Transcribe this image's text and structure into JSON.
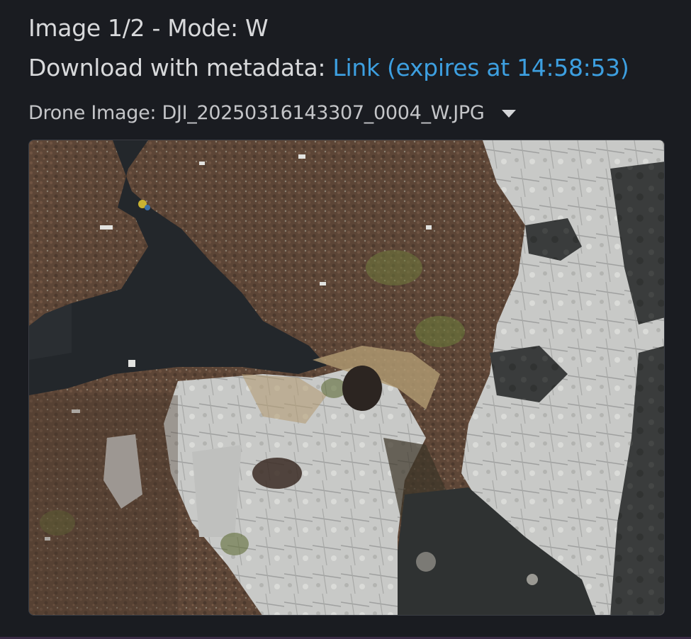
{
  "header": {
    "title": "Image 1/2 - Mode: W",
    "download_prefix": "Download with metadata: ",
    "download_link": "Link (expires at 14:58:53)"
  },
  "selector": {
    "label": "Drone Image: DJI_20250316143307_0004_W.JPG"
  },
  "image": {
    "alt": "Aerial drone photo of rocky coastline with heather moorland and dark water"
  },
  "colors": {
    "background": "#1a1c21",
    "link": "#3d9fe0",
    "text": "#d8d9db"
  },
  "icons": {
    "dropdown": "chevron-down-icon"
  }
}
